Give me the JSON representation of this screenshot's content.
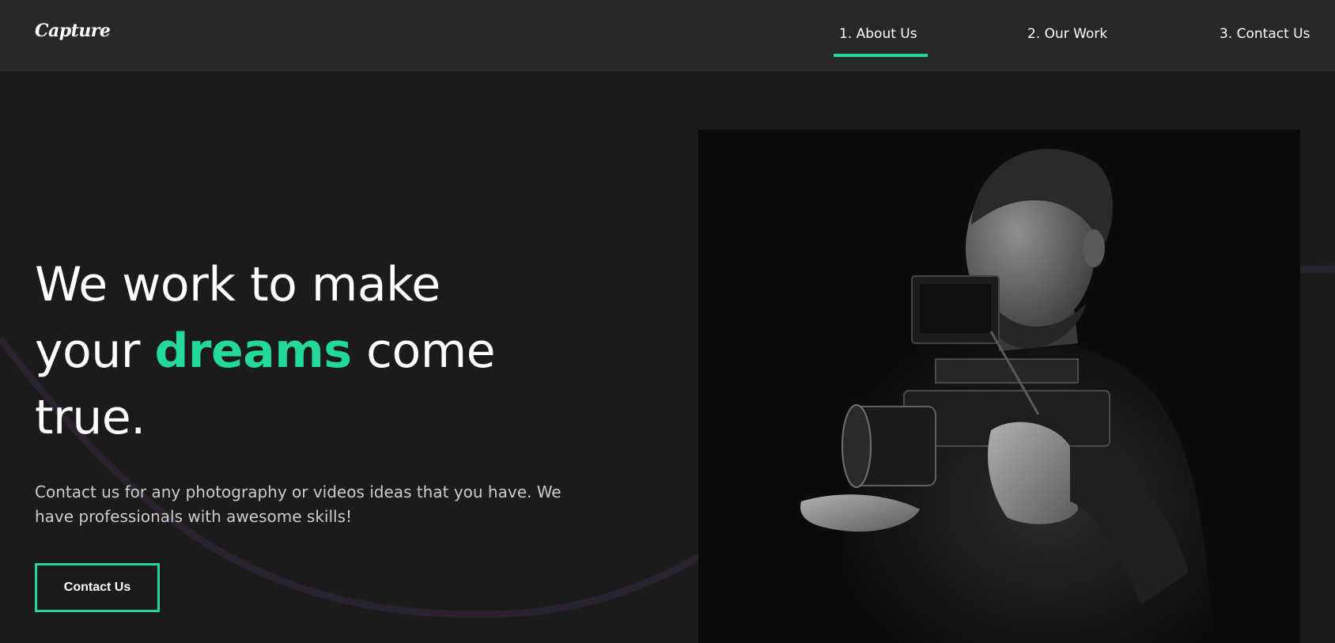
{
  "brand": {
    "logo": "Capture"
  },
  "nav": {
    "items": [
      {
        "label": "1. About Us",
        "active": true
      },
      {
        "label": "2. Our Work",
        "active": false
      },
      {
        "label": "3. Contact Us",
        "active": false
      }
    ]
  },
  "hero": {
    "heading": {
      "line1": "We work to make",
      "line2_pre": "your ",
      "highlight": "dreams",
      "line2_post": " come",
      "line3": "true."
    },
    "description": "Contact us for any photography or videos ideas that you have. We have professionals with awesome skills!",
    "button_label": "Contact Us",
    "image": "photographer-with-camera-rig"
  },
  "colors": {
    "accent": "#23d997",
    "background": "#1b1b1b",
    "navbar": "#282828",
    "decor_curve": "#2b2230"
  }
}
